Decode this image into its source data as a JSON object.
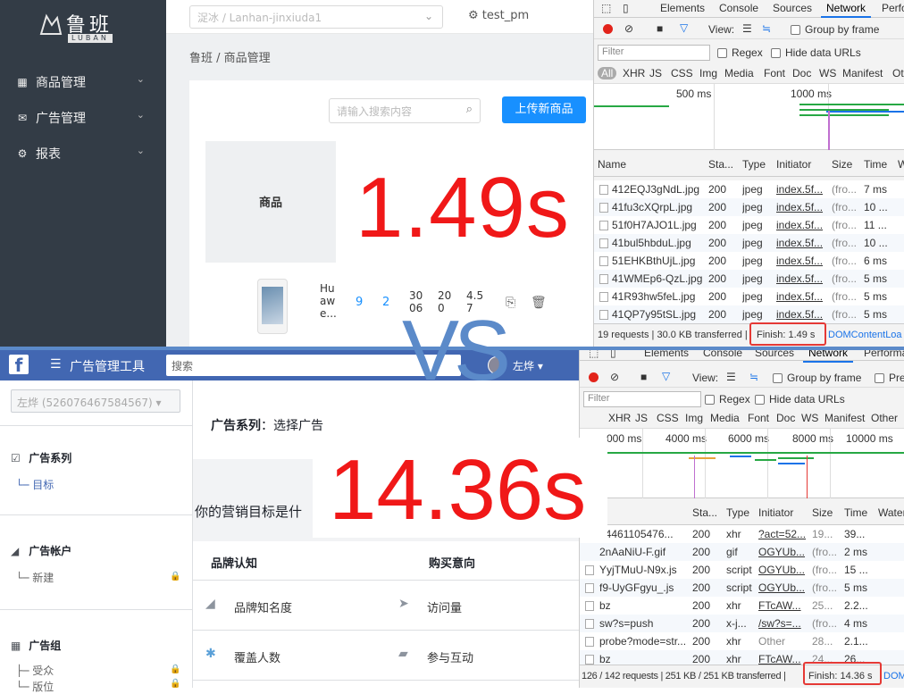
{
  "luban": {
    "logo_cn": "鲁班",
    "logo_en": "LUBAN",
    "menu": [
      {
        "icon": "grid-icon",
        "glyph": "▦",
        "label": "商品管理"
      },
      {
        "icon": "mail-icon",
        "glyph": "✉",
        "label": "广告管理"
      },
      {
        "icon": "gear-icon",
        "glyph": "⚙",
        "label": "报表"
      }
    ],
    "shop_select": "浞冰 / Lanhan-jinxiuda1",
    "user": "test_pm",
    "breadcrumb": "鲁班 / 商品管理",
    "search_placeholder": "请输入搜索内容",
    "upload_button": "上传新商品",
    "table_header": "商品",
    "row": {
      "name": "Hu aw e...",
      "c1": "9",
      "c2": "2",
      "c3": "30 06",
      "c4": "20 0",
      "c5": "4.5 7"
    }
  },
  "devtools_top": {
    "tabs": [
      "Elements",
      "Console",
      "Sources",
      "Network",
      "Perfo"
    ],
    "active_tab": "Network",
    "view_label": "View:",
    "group_label": "Group by frame",
    "filter_placeholder": "Filter",
    "regex_label": "Regex",
    "hide_label": "Hide data URLs",
    "types": [
      "All",
      "XHR",
      "JS",
      "CSS",
      "Img",
      "Media",
      "Font",
      "Doc",
      "WS",
      "Manifest",
      "Ot"
    ],
    "timeline": [
      "500 ms",
      "1000 ms"
    ],
    "headers": [
      "Name",
      "Sta...",
      "Type",
      "Initiator",
      "Size",
      "Time",
      "W"
    ],
    "rows": [
      [
        "412EQJ3gNdL.jpg",
        "200",
        "jpeg",
        "index.5f...",
        "(fro...",
        "7 ms"
      ],
      [
        "41fu3cXQrpL.jpg",
        "200",
        "jpeg",
        "index.5f...",
        "(fro...",
        "10 ..."
      ],
      [
        "51f0H7AJO1L.jpg",
        "200",
        "jpeg",
        "index.5f...",
        "(fro...",
        "11 ..."
      ],
      [
        "41bul5hbduL.jpg",
        "200",
        "jpeg",
        "index.5f...",
        "(fro...",
        "10 ..."
      ],
      [
        "51EHKBthUjL.jpg",
        "200",
        "jpeg",
        "index.5f...",
        "(fro...",
        "6 ms"
      ],
      [
        "41WMEp6-QzL.jpg",
        "200",
        "jpeg",
        "index.5f...",
        "(fro...",
        "5 ms"
      ],
      [
        "41R93hw5feL.jpg",
        "200",
        "jpeg",
        "index.5f...",
        "(fro...",
        "5 ms"
      ],
      [
        "41QP7y95tSL.jpg",
        "200",
        "jpeg",
        "index.5f...",
        "(fro...",
        "5 ms"
      ]
    ],
    "footer": "19 requests | 30.0 KB transferred |",
    "finish": "Finish: 1.49 s",
    "footer_tail": "DOMContentLoa"
  },
  "big_top": "1.49s",
  "vs": "VS",
  "big_bottom": "14.36s",
  "facebook": {
    "logo": "f",
    "menu_glyph": "☰",
    "title": "广告管理工具",
    "search_placeholder": "搜索",
    "account_name": "左烨 ▾",
    "account_select": "左烨 (526076467584567) ▾",
    "side": {
      "campaign": "广告系列",
      "objective": "目标",
      "account": "广告帐户",
      "create": "新建",
      "adset": "广告组",
      "audience": "受众",
      "placement": "版位"
    },
    "series_label": "广告系列",
    "series_value": "：选择广告",
    "question": "你的营销目标是什",
    "col1": "品牌认知",
    "col2": "购买意向",
    "opts": [
      {
        "icon": "megaphone-icon",
        "glyph": "◢",
        "label": "品牌知名度"
      },
      {
        "icon": "cursor-icon",
        "glyph": "➤",
        "label": "访问量"
      },
      {
        "icon": "sparkle-icon",
        "glyph": "✱",
        "label": "覆盖人数"
      },
      {
        "icon": "chat-icon",
        "glyph": "▰",
        "label": "参与互动"
      }
    ]
  },
  "devtools_bottom": {
    "tabs": [
      "Elements",
      "Console",
      "Sources",
      "Network",
      "Performa"
    ],
    "active_tab": "Network",
    "view_label": "View:",
    "group_label": "Group by frame",
    "pres_label": "Pre",
    "filter_placeholder": "Filter",
    "regex_label": "Regex",
    "hide_label": "Hide data URLs",
    "types": [
      "XHR",
      "JS",
      "CSS",
      "Img",
      "Media",
      "Font",
      "Doc",
      "WS",
      "Manifest",
      "Other"
    ],
    "timeline": [
      "000 ms",
      "4000 ms",
      "6000 ms",
      "8000 ms",
      "10000 ms"
    ],
    "headers": [
      "Sta...",
      "Type",
      "Initiator",
      "Size",
      "Time",
      "Water"
    ],
    "rows": [
      [
        "64461105476...",
        "200",
        "xhr",
        "?act=52...",
        "19...",
        "39..."
      ],
      [
        "2nAaNiU-F.gif",
        "200",
        "gif",
        "OGYUb...",
        "(fro...",
        "2 ms"
      ],
      [
        "YyjTMuU-N9x.js",
        "200",
        "script",
        "OGYUb...",
        "(fro...",
        "15 ..."
      ],
      [
        "f9-UyGFgyu_.js",
        "200",
        "script",
        "OGYUb...",
        "(fro...",
        "5 ms"
      ],
      [
        "bz",
        "200",
        "xhr",
        "FTcAW...",
        "25...",
        "2.2..."
      ],
      [
        "sw?s=push",
        "200",
        "x-j...",
        "/sw?s=...",
        "(fro...",
        "4 ms"
      ],
      [
        "probe?mode=str...",
        "200",
        "xhr",
        "Other",
        "28...",
        "2.1..."
      ],
      [
        "bz",
        "200",
        "xhr",
        "FTcAW...",
        "24...",
        "26..."
      ]
    ],
    "footer": "126 / 142 requests | 251 KB / 251 KB transferred |",
    "finish": "Finish: 14.36 s",
    "footer_tail": "DOM"
  }
}
